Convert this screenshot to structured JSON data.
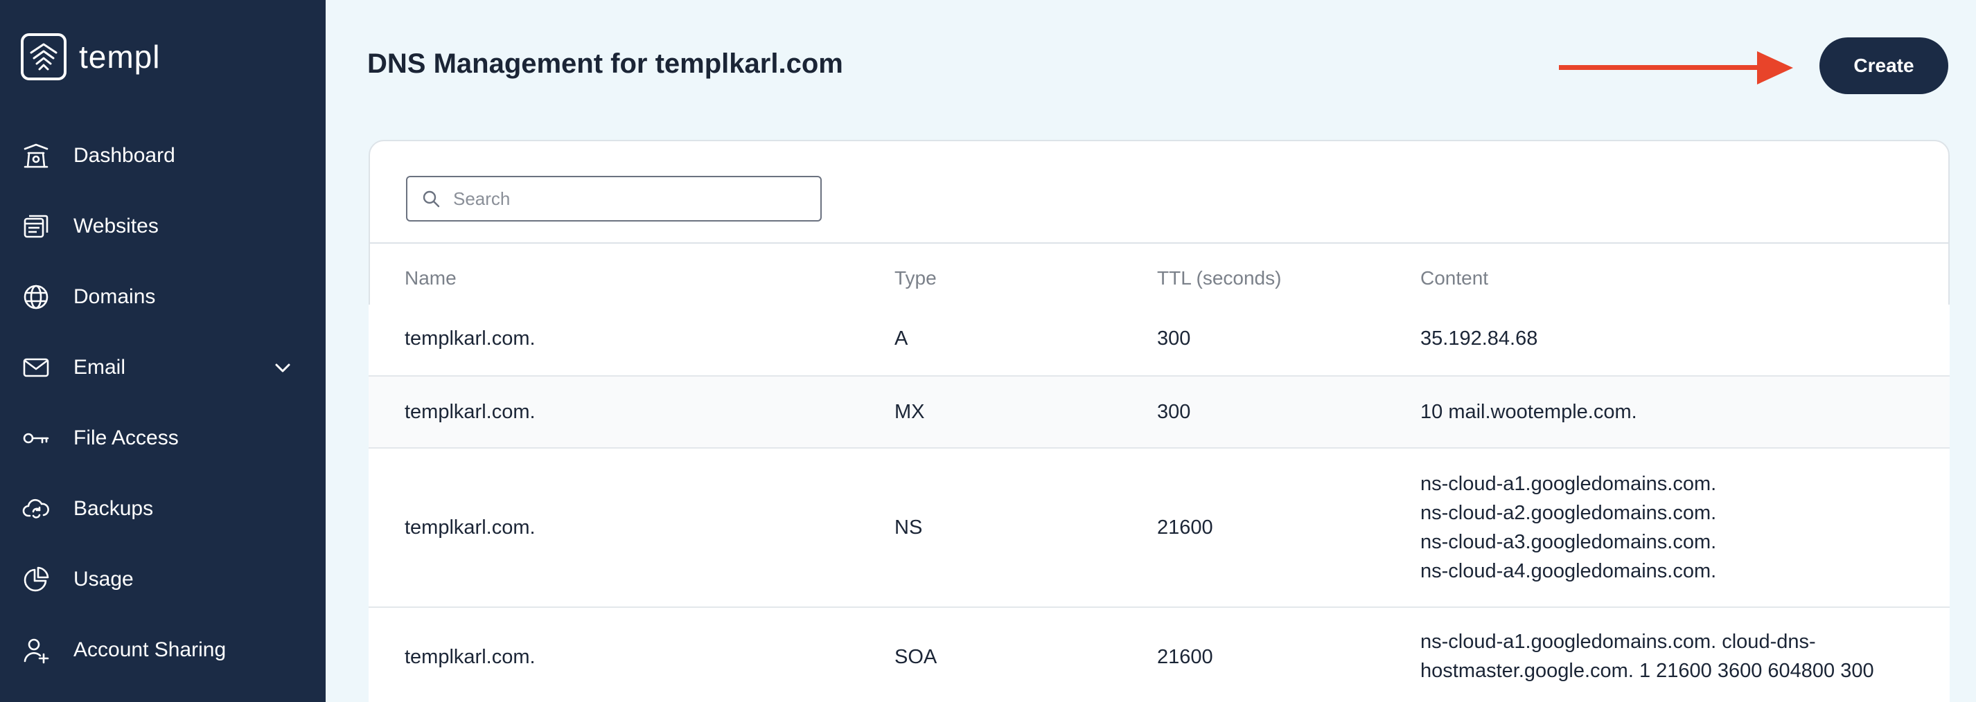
{
  "app": {
    "logo_text": "templ"
  },
  "sidebar": {
    "items": [
      {
        "label": "Dashboard",
        "icon": "dashboard-icon"
      },
      {
        "label": "Websites",
        "icon": "websites-icon"
      },
      {
        "label": "Domains",
        "icon": "globe-www-icon"
      },
      {
        "label": "Email",
        "icon": "envelope-icon",
        "expandable": true
      },
      {
        "label": "File Access",
        "icon": "key-icon"
      },
      {
        "label": "Backups",
        "icon": "cloud-refresh-icon"
      },
      {
        "label": "Usage",
        "icon": "pie-chart-icon"
      },
      {
        "label": "Account Sharing",
        "icon": "add-user-icon"
      }
    ]
  },
  "header": {
    "title": "DNS Management for templkarl.com",
    "create_label": "Create"
  },
  "search": {
    "placeholder": "Search",
    "value": ""
  },
  "table": {
    "columns": [
      "Name",
      "Type",
      "TTL (seconds)",
      "Content"
    ],
    "rows": [
      {
        "name": "templkarl.com.",
        "type": "A",
        "ttl": "300",
        "content": [
          "35.192.84.68"
        ]
      },
      {
        "name": "templkarl.com.",
        "type": "MX",
        "ttl": "300",
        "content": [
          "10 mail.wootemple.com."
        ]
      },
      {
        "name": "templkarl.com.",
        "type": "NS",
        "ttl": "21600",
        "content": [
          "ns-cloud-a1.googledomains.com.",
          "ns-cloud-a2.googledomains.com.",
          "ns-cloud-a3.googledomains.com.",
          "ns-cloud-a4.googledomains.com."
        ]
      },
      {
        "name": "templkarl.com.",
        "type": "SOA",
        "ttl": "21600",
        "content": [
          "ns-cloud-a1.googledomains.com. cloud-dns-",
          "hostmaster.google.com. 1 21600 3600 604800 300"
        ]
      }
    ]
  },
  "colors": {
    "sidebar_bg": "#1b2b45",
    "page_bg": "#eef7fb",
    "accent_arrow": "#e8442a"
  }
}
